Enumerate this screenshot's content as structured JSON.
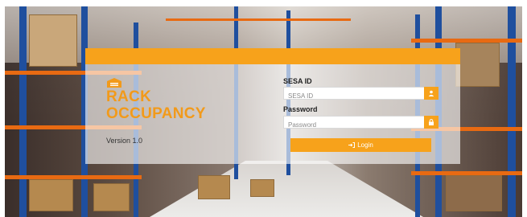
{
  "app": {
    "brand_line1": "RACK",
    "brand_line2": "OCCUPANCY",
    "version": "Version 1.0",
    "accent_color": "#f7a21b"
  },
  "login_form": {
    "sesa_id_label": "SESA ID",
    "sesa_id_placeholder": "SESA ID",
    "sesa_id_value": "",
    "password_label": "Password",
    "password_placeholder": "Password",
    "password_value": "",
    "login_label": "Login"
  },
  "icons": {
    "logo": "warehouse-icon",
    "user": "user-icon",
    "lock": "lock-icon",
    "login": "sign-in-icon"
  }
}
